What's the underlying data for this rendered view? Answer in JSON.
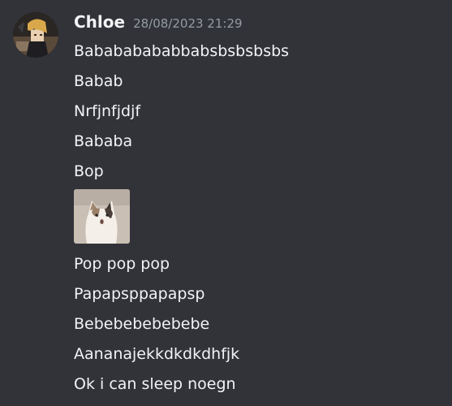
{
  "message": {
    "author": "Chloe",
    "timestamp": "28/08/2023 21:29",
    "lines_before_image": [
      "Babababababbabsbsbsbsbs",
      "Babab",
      "Nrfjnfjdjf",
      "Bababa",
      "Bop"
    ],
    "lines_after_image": [
      "Pop pop pop",
      "Papapsppapapsp",
      "Bebebebebebebe",
      "Aananajekkdkdkdhfjk",
      "Ok i can sleep noegn"
    ]
  },
  "colors": {
    "background": "#313338",
    "text": "#f2f3f5",
    "muted": "#949ba4"
  },
  "icons": {
    "avatar": "anime-character-avatar",
    "attachment": "pop-cat-image"
  }
}
